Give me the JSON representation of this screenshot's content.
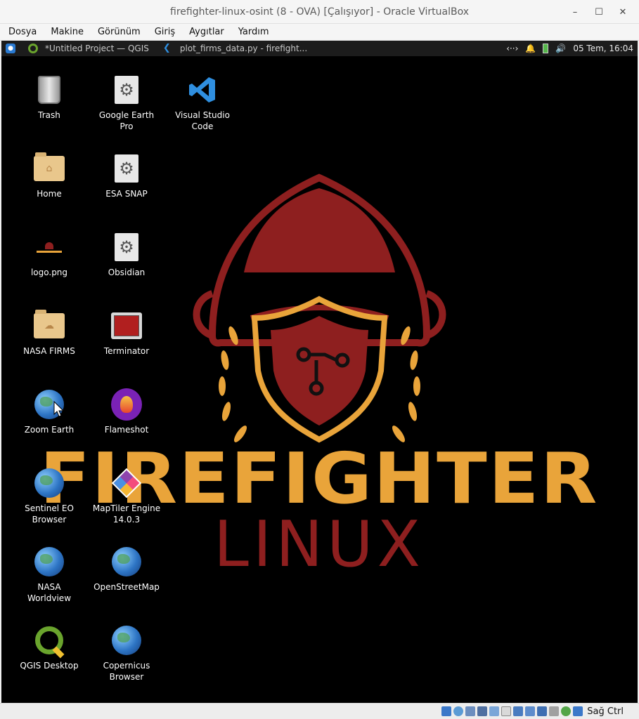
{
  "window": {
    "title": "firefighter-linux-osint (8 - OVA) [Çalışıyor] - Oracle VirtualBox",
    "minimize": "–",
    "maximize": "☐",
    "close": "✕"
  },
  "menubar": [
    "Dosya",
    "Makine",
    "Görünüm",
    "Giriş",
    "Aygıtlar",
    "Yardım"
  ],
  "panel": {
    "tasks": [
      {
        "label": "*Untitled Project — QGIS",
        "icon": "qgis-icon"
      },
      {
        "label": "plot_firms_data.py - firefight...",
        "icon": "vscode-icon"
      }
    ],
    "network": "‹··›",
    "clock": "05 Tem, 16:04"
  },
  "wallpaper": {
    "title": "FIREFIGHTER",
    "subtitle": "LINUX",
    "title_color": "#e9a43a",
    "subtitle_color": "#8e1f1f",
    "helmet_color": "#8e1f1f"
  },
  "desktop_icons": [
    {
      "label": "Trash",
      "kind": "trash-icon"
    },
    {
      "label": "Google Earth\nPro",
      "kind": "gear-icon"
    },
    {
      "label": "Visual Studio\nCode",
      "kind": "vscode-icon"
    },
    {
      "label": "Home",
      "kind": "home-folder-icon"
    },
    {
      "label": "ESA SNAP",
      "kind": "gear-icon"
    },
    {
      "label": "logo.png",
      "kind": "image-file-icon"
    },
    {
      "label": "Obsidian",
      "kind": "gear-icon"
    },
    {
      "label": "NASA FIRMS",
      "kind": "folder-icon"
    },
    {
      "label": "Terminator",
      "kind": "terminal-icon"
    },
    {
      "label": "Zoom Earth",
      "kind": "globe-icon"
    },
    {
      "label": "Flameshot",
      "kind": "flameshot-icon"
    },
    {
      "label": "Sentinel EO\nBrowser",
      "kind": "globe-icon"
    },
    {
      "label": "MapTiler Engine\n14.0.3",
      "kind": "maptiler-icon"
    },
    {
      "label": "NASA\nWorldview",
      "kind": "globe-icon"
    },
    {
      "label": "OpenStreetMap",
      "kind": "globe-icon"
    },
    {
      "label": "QGIS Desktop",
      "kind": "qgis-icon"
    },
    {
      "label": "Copernicus\nBrowser",
      "kind": "globe-icon"
    }
  ],
  "statusbar": {
    "host_key": "Sağ Ctrl"
  }
}
